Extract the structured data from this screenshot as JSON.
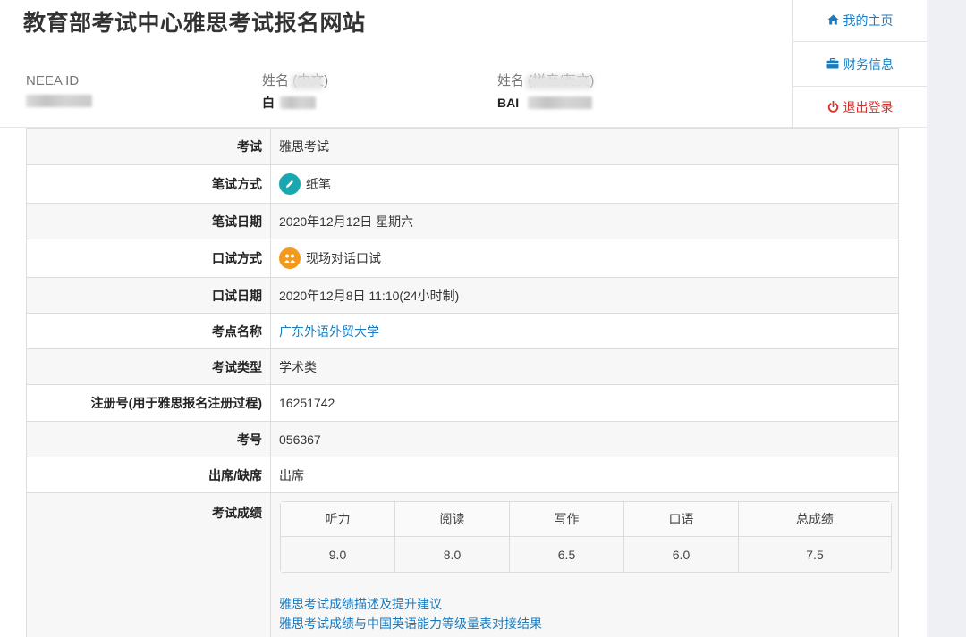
{
  "header": {
    "site_title": "教育部考试中心雅思考试报名网站",
    "neea_id_label": "NEEA ID",
    "name_cn_label": "姓名 (中文)",
    "name_cn_value": "白",
    "name_en_label": "姓名 (拼音/英文)",
    "name_en_value": "BAI"
  },
  "nav": {
    "home": "我的主页",
    "finance": "财务信息",
    "logout": "退出登录"
  },
  "details": {
    "exam_label": "考试",
    "exam_value": "雅思考试",
    "written_mode_label": "笔试方式",
    "written_mode_value": "纸笔",
    "written_date_label": "笔试日期",
    "written_date_value": "2020年12月12日 星期六",
    "oral_mode_label": "口试方式",
    "oral_mode_value": "现场对话口试",
    "oral_date_label": "口试日期",
    "oral_date_value": "2020年12月8日 11:10(24小时制)",
    "center_label": "考点名称",
    "center_value": "广东外语外贸大学",
    "type_label": "考试类型",
    "type_value": "学术类",
    "reg_label": "注册号(用于雅思报名注册过程)",
    "reg_value": "16251742",
    "candidate_label": "考号",
    "candidate_value": "056367",
    "attendance_label": "出席/缺席",
    "attendance_value": "出席",
    "score_label": "考试成绩"
  },
  "scores": {
    "headers": [
      "听力",
      "阅读",
      "写作",
      "口语",
      "总成绩"
    ],
    "values": [
      "9.0",
      "8.0",
      "6.5",
      "6.0",
      "7.5"
    ]
  },
  "score_links": {
    "description": "雅思考试成绩描述及提升建议",
    "cse": "雅思考试成绩与中国英语能力等级量表对接结果"
  },
  "colors": {
    "link": "#1a7bbf",
    "logout": "#d9302a",
    "pen_badge": "#1aa7b0",
    "oral_badge": "#f39a1e"
  }
}
